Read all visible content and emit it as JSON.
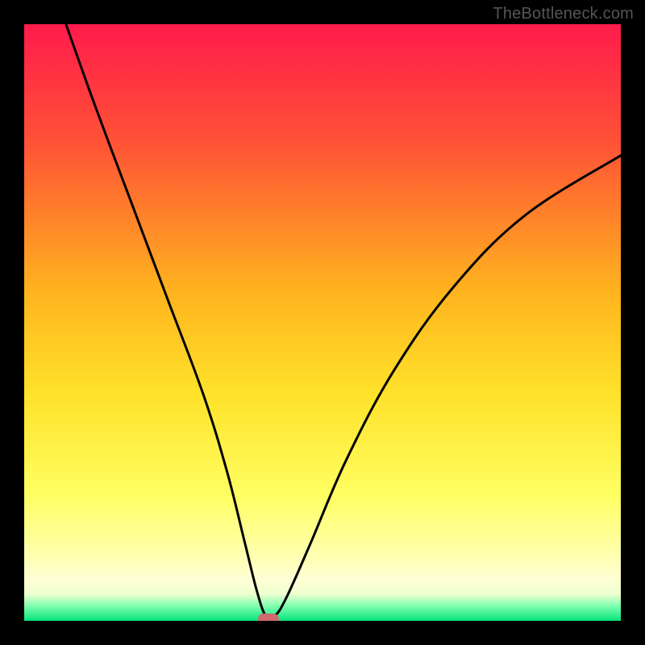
{
  "watermark": "TheBottleneck.com",
  "chart_data": {
    "type": "line",
    "title": "",
    "xlabel": "",
    "ylabel": "",
    "xlim": [
      0,
      100
    ],
    "ylim": [
      0,
      100
    ],
    "gradient_stops": [
      {
        "offset": 0,
        "color": "#ff1b4b"
      },
      {
        "offset": 20,
        "color": "#ff5336"
      },
      {
        "offset": 45,
        "color": "#ffb41e"
      },
      {
        "offset": 62,
        "color": "#ffe22a"
      },
      {
        "offset": 79,
        "color": "#ffff62"
      },
      {
        "offset": 89,
        "color": "#ffffaf"
      },
      {
        "offset": 93,
        "color": "#ffffd5"
      },
      {
        "offset": 95.5,
        "color": "#efffd0"
      },
      {
        "offset": 97.5,
        "color": "#80ffb0"
      },
      {
        "offset": 100,
        "color": "#05e47a"
      }
    ],
    "series": [
      {
        "name": "bottleneck-curve",
        "points": [
          {
            "x": 7,
            "y": 100
          },
          {
            "x": 12,
            "y": 86
          },
          {
            "x": 18,
            "y": 70
          },
          {
            "x": 24,
            "y": 54
          },
          {
            "x": 30,
            "y": 38
          },
          {
            "x": 34,
            "y": 25
          },
          {
            "x": 37,
            "y": 13
          },
          {
            "x": 39,
            "y": 5
          },
          {
            "x": 40.5,
            "y": 0.8
          },
          {
            "x": 42,
            "y": 0.8
          },
          {
            "x": 44,
            "y": 4
          },
          {
            "x": 48,
            "y": 13
          },
          {
            "x": 54,
            "y": 27
          },
          {
            "x": 62,
            "y": 42
          },
          {
            "x": 72,
            "y": 56
          },
          {
            "x": 84,
            "y": 68
          },
          {
            "x": 100,
            "y": 78
          }
        ]
      }
    ],
    "marker": {
      "x": 41,
      "y": 0.3,
      "color": "#cf6a6e"
    }
  }
}
